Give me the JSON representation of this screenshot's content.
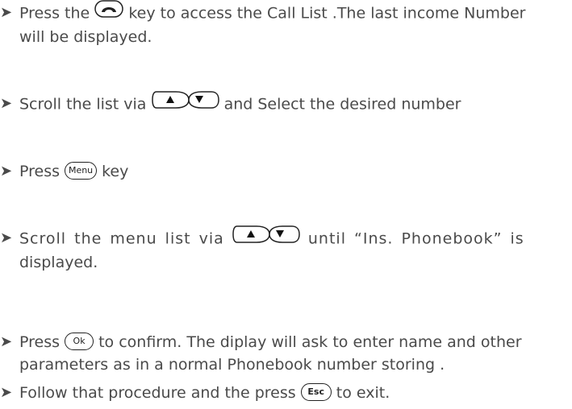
{
  "steps": [
    {
      "arrow": "➤",
      "parts": [
        "Press the",
        "key to access the Call List .The last income Number",
        "will be displayed."
      ],
      "icon": "call-key-icon"
    },
    {
      "arrow": "➤",
      "parts": [
        "Scroll the list via",
        "and Select the desired number"
      ],
      "icon": "up-down-keys-icon"
    },
    {
      "arrow": "➤",
      "parts": [
        "Press",
        "key"
      ],
      "key_label": "Menu"
    },
    {
      "arrow": "➤",
      "parts": [
        "Scroll the menu list via",
        "until “Ins. Phonebook” is",
        "displayed."
      ],
      "icon": "up-down-keys-icon"
    },
    {
      "arrow": "➤",
      "parts": [
        "Press",
        "to confirm. The diplay will ask to enter name and other",
        "parameters  as in a normal Phonebook number storing ."
      ],
      "key_label": "Ok"
    },
    {
      "arrow": "➤",
      "parts": [
        "Follow that procedure and the press",
        "to exit."
      ],
      "key_label": "Esc"
    }
  ],
  "keys": {
    "up_symbol": "▲",
    "down_symbol": "▼"
  }
}
